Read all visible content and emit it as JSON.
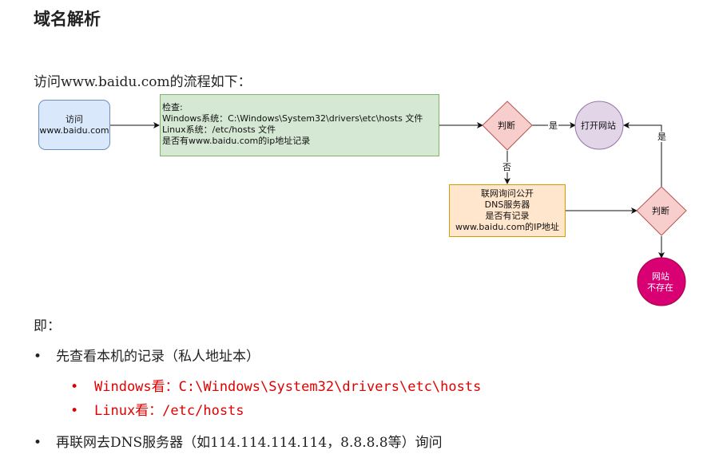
{
  "title": "域名解析",
  "intro": "访问www.baidu.com的流程如下：",
  "diagram": {
    "visit_box": [
      "访问",
      "www.baidu.com"
    ],
    "check_box": [
      "检查:",
      "Windows系统：C:\\Windows\\System32\\drivers\\etc\\hosts 文件",
      "Linux系统：/etc/hosts 文件",
      "是否有www.baidu.com的ip地址记录"
    ],
    "decision1": "判断",
    "yes1": "是",
    "open_site": "打开网站",
    "no1": "否",
    "dns_box": [
      "联网询问公开",
      "DNS服务器",
      "是否有记录",
      "www.baidu.com的IP地址"
    ],
    "decision2": "判断",
    "yes2": "是",
    "not_exist": [
      "网站",
      "不存在"
    ],
    "colors": {
      "visit_fill": "#dae8fc",
      "visit_stroke": "#6c8ebf",
      "check_fill": "#d5e8d4",
      "check_stroke": "#82b366",
      "decision_fill": "#f8cecc",
      "decision_stroke": "#b85450",
      "open_fill": "#e1d5e7",
      "open_stroke": "#9673a6",
      "dns_fill": "#ffe6cc",
      "dns_stroke": "#d79b00",
      "not_exist_fill": "#d80073"
    }
  },
  "jishi": "即：",
  "bullets": {
    "b1": "先查看本机的记录（私人地址本）",
    "b1_sub": [
      "Windows看：C:\\Windows\\System32\\drivers\\etc\\hosts",
      "Linux看：/etc/hosts"
    ],
    "b2": "再联网去DNS服务器（如114.114.114.114，8.8.8.8等）询问",
    "sub_color": "#e00000"
  }
}
